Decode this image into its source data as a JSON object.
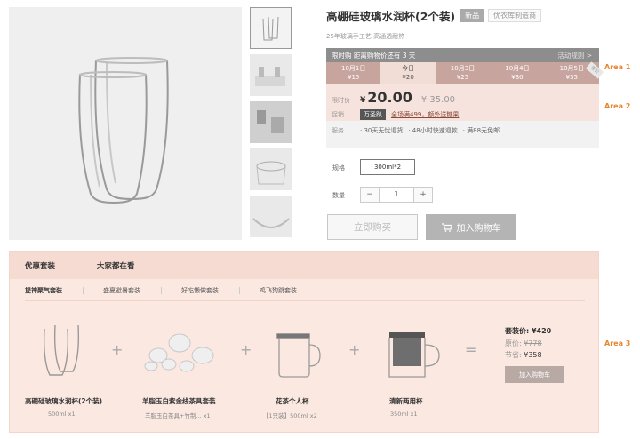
{
  "product": {
    "title": "高硼硅玻璃水润杯(2个装)",
    "badge_new": "新品",
    "badge_dc": "优衣库制造商",
    "subtitle": "25年玻璃手工艺 高通透耐热"
  },
  "promo": {
    "header": "限时购  距离购物价还有 3 天",
    "rule": "活动规则 >",
    "dates": [
      {
        "label": "10月1日",
        "price": "¥15"
      },
      {
        "label": "今日",
        "price": "¥20"
      },
      {
        "label": "10月3日",
        "price": "¥25"
      },
      {
        "label": "10月4日",
        "price": "¥30"
      },
      {
        "label": "10月5日",
        "price": "¥35",
        "tag": "原价"
      }
    ]
  },
  "price": {
    "label": "限时价",
    "currency": "¥",
    "value": "20.00",
    "original": "¥ 35.00",
    "promo_label": "促销",
    "promo_tag": "万圣趴",
    "promo_text": "全场满499，额外送糖果",
    "service_label": "服务",
    "services": [
      "· 30天无忧退货",
      "· 48小时快速退款",
      "· 满88元免邮"
    ]
  },
  "options": {
    "spec_label": "规格",
    "spec_value": "300ml*2",
    "qty_label": "数量",
    "qty_minus": "−",
    "qty_value": "1",
    "qty_plus": "+"
  },
  "buttons": {
    "buy": "立即购买",
    "cart": "加入购物车"
  },
  "areas": {
    "a1": "Area 1",
    "a2": "Area 2",
    "a3": "Area 3"
  },
  "bundle": {
    "tab_bundle": "优惠套装",
    "tab_popular": "大家都在看",
    "sub_tabs": [
      "提神聚气套装",
      "盛夏避暑套装",
      "好吃懒做套装",
      "鸡飞狗跳套装"
    ],
    "items": [
      {
        "name": "高硼硅玻璃水润杯(2个装)",
        "detail": "500ml   x1"
      },
      {
        "name": "羊脂玉白紫金线茶具套装",
        "detail": "羊脂玉白茶具+竹制...   x1"
      },
      {
        "name": "花茶个人杯",
        "detail": "【1只装】500ml   x2"
      },
      {
        "name": "清新两用杯",
        "detail": "350ml   x1"
      }
    ],
    "total_label": "套装价: ¥420",
    "orig_label": "原价: ",
    "orig_value": "¥778",
    "save_label": "节省: ",
    "save_value": "¥358",
    "add_button": "加入购物车"
  }
}
